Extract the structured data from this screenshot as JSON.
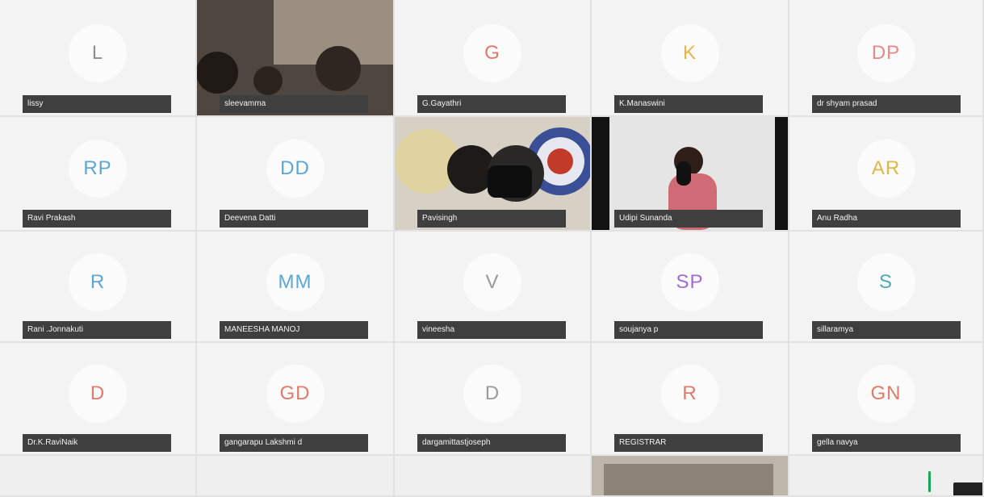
{
  "participants": [
    {
      "initials": "L",
      "name": "lissy",
      "color": "#8f8f8f",
      "type": "avatar"
    },
    {
      "initials": "",
      "name": "sleevamma",
      "color": "",
      "type": "video"
    },
    {
      "initials": "G",
      "name": "G.Gayathri",
      "color": "#e07a6b",
      "type": "avatar"
    },
    {
      "initials": "K",
      "name": "K.Manaswini",
      "color": "#e3b64a",
      "type": "avatar"
    },
    {
      "initials": "DP",
      "name": "dr shyam prasad",
      "color": "#e58a8a",
      "type": "avatar"
    },
    {
      "initials": "RP",
      "name": "Ravi Prakash",
      "color": "#5aa7d6",
      "type": "avatar"
    },
    {
      "initials": "DD",
      "name": "Deevena Datti",
      "color": "#5aa7d6",
      "type": "avatar"
    },
    {
      "initials": "",
      "name": "Pavisingh",
      "color": "",
      "type": "video"
    },
    {
      "initials": "",
      "name": "Udipi Sunanda",
      "color": "",
      "type": "video"
    },
    {
      "initials": "AR",
      "name": "Anu Radha",
      "color": "#e3b64a",
      "type": "avatar"
    },
    {
      "initials": "R",
      "name": "Rani .Jonnakuti",
      "color": "#5aa7d6",
      "type": "avatar"
    },
    {
      "initials": "MM",
      "name": "MANEESHA MANOJ",
      "color": "#5aa7d6",
      "type": "avatar"
    },
    {
      "initials": "V",
      "name": "vineesha",
      "color": "#9a9a9a",
      "type": "avatar"
    },
    {
      "initials": "SP",
      "name": "soujanya p",
      "color": "#a36bd0",
      "type": "avatar"
    },
    {
      "initials": "S",
      "name": "sillaramya",
      "color": "#4fa9b8",
      "type": "avatar"
    },
    {
      "initials": "D",
      "name": "Dr.K.RaviNaik",
      "color": "#e07a6b",
      "type": "avatar"
    },
    {
      "initials": "GD",
      "name": "gangarapu Lakshmi d",
      "color": "#e07a6b",
      "type": "avatar"
    },
    {
      "initials": "D",
      "name": "dargamittastjoseph",
      "color": "#9a9a9a",
      "type": "avatar"
    },
    {
      "initials": "R",
      "name": "REGISTRAR",
      "color": "#e07a6b",
      "type": "avatar"
    },
    {
      "initials": "GN",
      "name": "gella navya",
      "color": "#e07a6b",
      "type": "avatar"
    }
  ]
}
